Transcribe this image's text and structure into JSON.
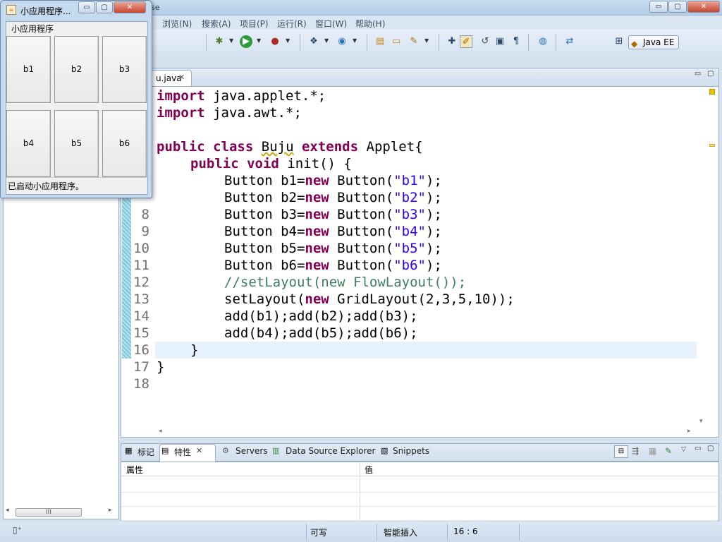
{
  "window": {
    "title_partial": "se",
    "controls": {
      "minimize": "▭",
      "maximize": "▢",
      "close": "✕"
    }
  },
  "menubar": {
    "items": [
      "浏览(N)",
      "搜索(A)",
      "项目(P)",
      "运行(R)",
      "窗口(W)",
      "帮助(H)"
    ]
  },
  "toolbar": {
    "perspective_label": "Java EE",
    "icons": [
      "debug-icon",
      "run-icon",
      "run-external-icon",
      "new-server-icon",
      "new-class-icon",
      "open-type-icon",
      "open-folder-icon",
      "search-icon",
      "toggle-mark-icon",
      "highlight-icon",
      "toggle-block-icon",
      "show-whitespace-icon",
      "globe-icon",
      "web-browser-icon",
      "open-perspective-icon"
    ]
  },
  "editor": {
    "tab_label": "u.java",
    "tab_close": "✕",
    "line_numbers": [
      "8",
      "9",
      "10",
      "11",
      "12",
      "13",
      "14",
      "15",
      "16",
      "17",
      "18"
    ],
    "code": [
      {
        "kind": "import",
        "kw": "import",
        "text": " java.applet.*;"
      },
      {
        "kind": "import",
        "kw": "import",
        "text": " java.awt.*;"
      },
      {
        "kind": "blank"
      },
      {
        "kind": "class",
        "kw1": "public",
        "kw2": "class",
        "name": "Buju",
        "kw3": "extends",
        "text": "Applet{"
      },
      {
        "kind": "method",
        "kw1": "public",
        "kw2": "void",
        "text": "init() {"
      },
      {
        "kind": "new",
        "lhs": "Button b1=",
        "kw": "new",
        "ctor": " Button(",
        "str": "\"b1\"",
        "end": ");"
      },
      {
        "kind": "new",
        "lhs": "Button b2=",
        "kw": "new",
        "ctor": " Button(",
        "str": "\"b2\"",
        "end": ");"
      },
      {
        "kind": "new",
        "lhs": "Button b3=",
        "kw": "new",
        "ctor": " Button(",
        "str": "\"b3\"",
        "end": ");"
      },
      {
        "kind": "new",
        "lhs": "Button b4=",
        "kw": "new",
        "ctor": " Button(",
        "str": "\"b4\"",
        "end": ");"
      },
      {
        "kind": "new",
        "lhs": "Button b5=",
        "kw": "new",
        "ctor": " Button(",
        "str": "\"b5\"",
        "end": ");"
      },
      {
        "kind": "new",
        "lhs": "Button b6=",
        "kw": "new",
        "ctor": " Button(",
        "str": "\"b6\"",
        "end": ");"
      },
      {
        "kind": "comment",
        "text": "//setLayout(new FlowLayout());"
      },
      {
        "kind": "setlayout",
        "pre": "setLayout(",
        "kw": "new",
        "text": " GridLayout(2,3,5,10));"
      },
      {
        "kind": "plain",
        "text": "add(b1);add(b2);add(b3);"
      },
      {
        "kind": "plain",
        "text": "add(b4);add(b5);add(b6);"
      },
      {
        "kind": "plain",
        "text": "}"
      },
      {
        "kind": "plain",
        "text": "}"
      },
      {
        "kind": "blank"
      }
    ]
  },
  "bottom_panel": {
    "tabs": [
      "标记",
      "特性",
      "Servers",
      "Data Source Explorer",
      "Snippets"
    ],
    "active_close": "✕",
    "columns": [
      "属性",
      "值"
    ]
  },
  "statusbar": {
    "writable": "可写",
    "insert_mode": "智能插入",
    "position": "16 : 6"
  },
  "applet": {
    "title": "小应用程序...",
    "menu_label": "小应用程序",
    "buttons": [
      "b1",
      "b2",
      "b3",
      "b4",
      "b5",
      "b6"
    ],
    "status": "已启动小应用程序。",
    "controls": {
      "minimize": "▭",
      "maximize": "▢",
      "close": "✕"
    }
  }
}
